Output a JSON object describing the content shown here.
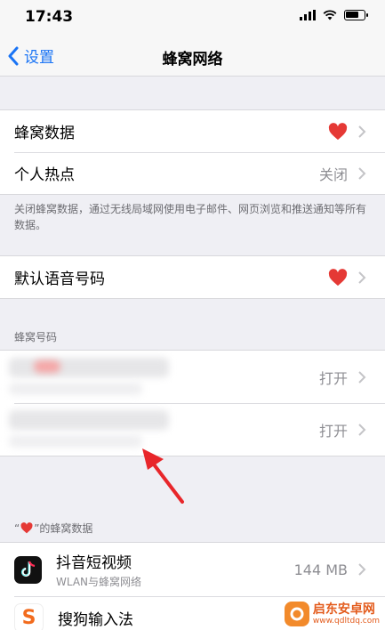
{
  "status_bar": {
    "time": "17:43"
  },
  "nav": {
    "back_label": "设置",
    "title": "蜂窝网络"
  },
  "group1": {
    "cellular_data_label": "蜂窝数据",
    "hotspot_label": "个人热点",
    "hotspot_value": "关闭"
  },
  "group1_footnote": "关闭蜂窝数据，通过无线局域网使用电子邮件、网页浏览和推送通知等所有数据。",
  "group2": {
    "default_voice_label": "默认语音号码"
  },
  "numbers_section": {
    "header": "蜂窝号码",
    "items": [
      {
        "value": "打开"
      },
      {
        "value": "打开"
      }
    ]
  },
  "app_data_section": {
    "header_prefix": "“",
    "header_suffix": "”的蜂窝数据",
    "apps": [
      {
        "name": "抖音短视频",
        "sub": "WLAN与蜂窝网络",
        "size": "144 MB"
      },
      {
        "name": "搜狗输入法",
        "sub": "",
        "size": ""
      }
    ]
  },
  "watermark": {
    "title": "启东安卓网",
    "url": "www.qdltdq.com"
  },
  "colors": {
    "accent": "#1a74f5",
    "heart": "#e53935",
    "arrow": "#e8262a"
  }
}
